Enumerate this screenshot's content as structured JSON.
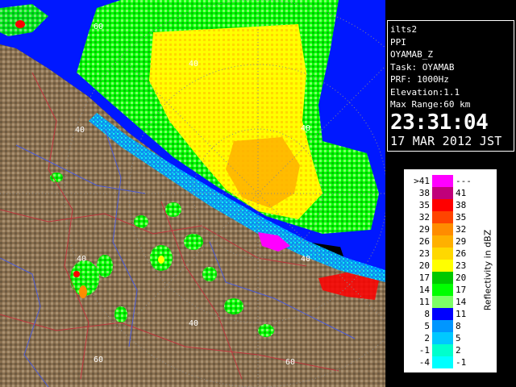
{
  "radar": {
    "ring_labels": [
      "60",
      "40",
      "40",
      "40",
      "40",
      "40",
      "60",
      "40",
      "60"
    ]
  },
  "info": {
    "radar_name": "ilts2",
    "scan_type": "PPI",
    "product": "OYAMAB_Z",
    "task": "Task: OYAMAB",
    "prf": "PRF: 1000Hz",
    "elevation": "Elevation:1.1",
    "max_range": "Max Range:60 km",
    "time": "23:31:04",
    "date": "17 MAR 2012 JST"
  },
  "legend": {
    "title": "Reflectivity in dBZ",
    "rows": [
      {
        "low": ">41",
        "high": "---",
        "color": "#ff00ff"
      },
      {
        "low": "38",
        "high": "41",
        "color": "#c0007a"
      },
      {
        "low": "35",
        "high": "38",
        "color": "#ff0000"
      },
      {
        "low": "32",
        "high": "35",
        "color": "#ff4400"
      },
      {
        "low": "29",
        "high": "32",
        "color": "#ff8c00"
      },
      {
        "low": "26",
        "high": "29",
        "color": "#ffb000"
      },
      {
        "low": "23",
        "high": "26",
        "color": "#ffd800"
      },
      {
        "low": "20",
        "high": "23",
        "color": "#ffff00"
      },
      {
        "low": "17",
        "high": "20",
        "color": "#00c800"
      },
      {
        "low": "14",
        "high": "17",
        "color": "#00ff00"
      },
      {
        "low": "11",
        "high": "14",
        "color": "#7cff66"
      },
      {
        "low": "8",
        "high": "11",
        "color": "#0000ff"
      },
      {
        "low": "5",
        "high": "8",
        "color": "#0096ff"
      },
      {
        "low": "2",
        "high": "5",
        "color": "#00c8ff"
      },
      {
        "low": "-1",
        "high": "2",
        "color": "#00ffcc"
      },
      {
        "low": "-4",
        "high": "-1",
        "color": "#00ffff"
      }
    ]
  },
  "colors": {
    "sea": "#0018ff",
    "land": "#8a7050",
    "boundary_red": "#c0343c",
    "boundary_blue": "#4a5ad8"
  }
}
